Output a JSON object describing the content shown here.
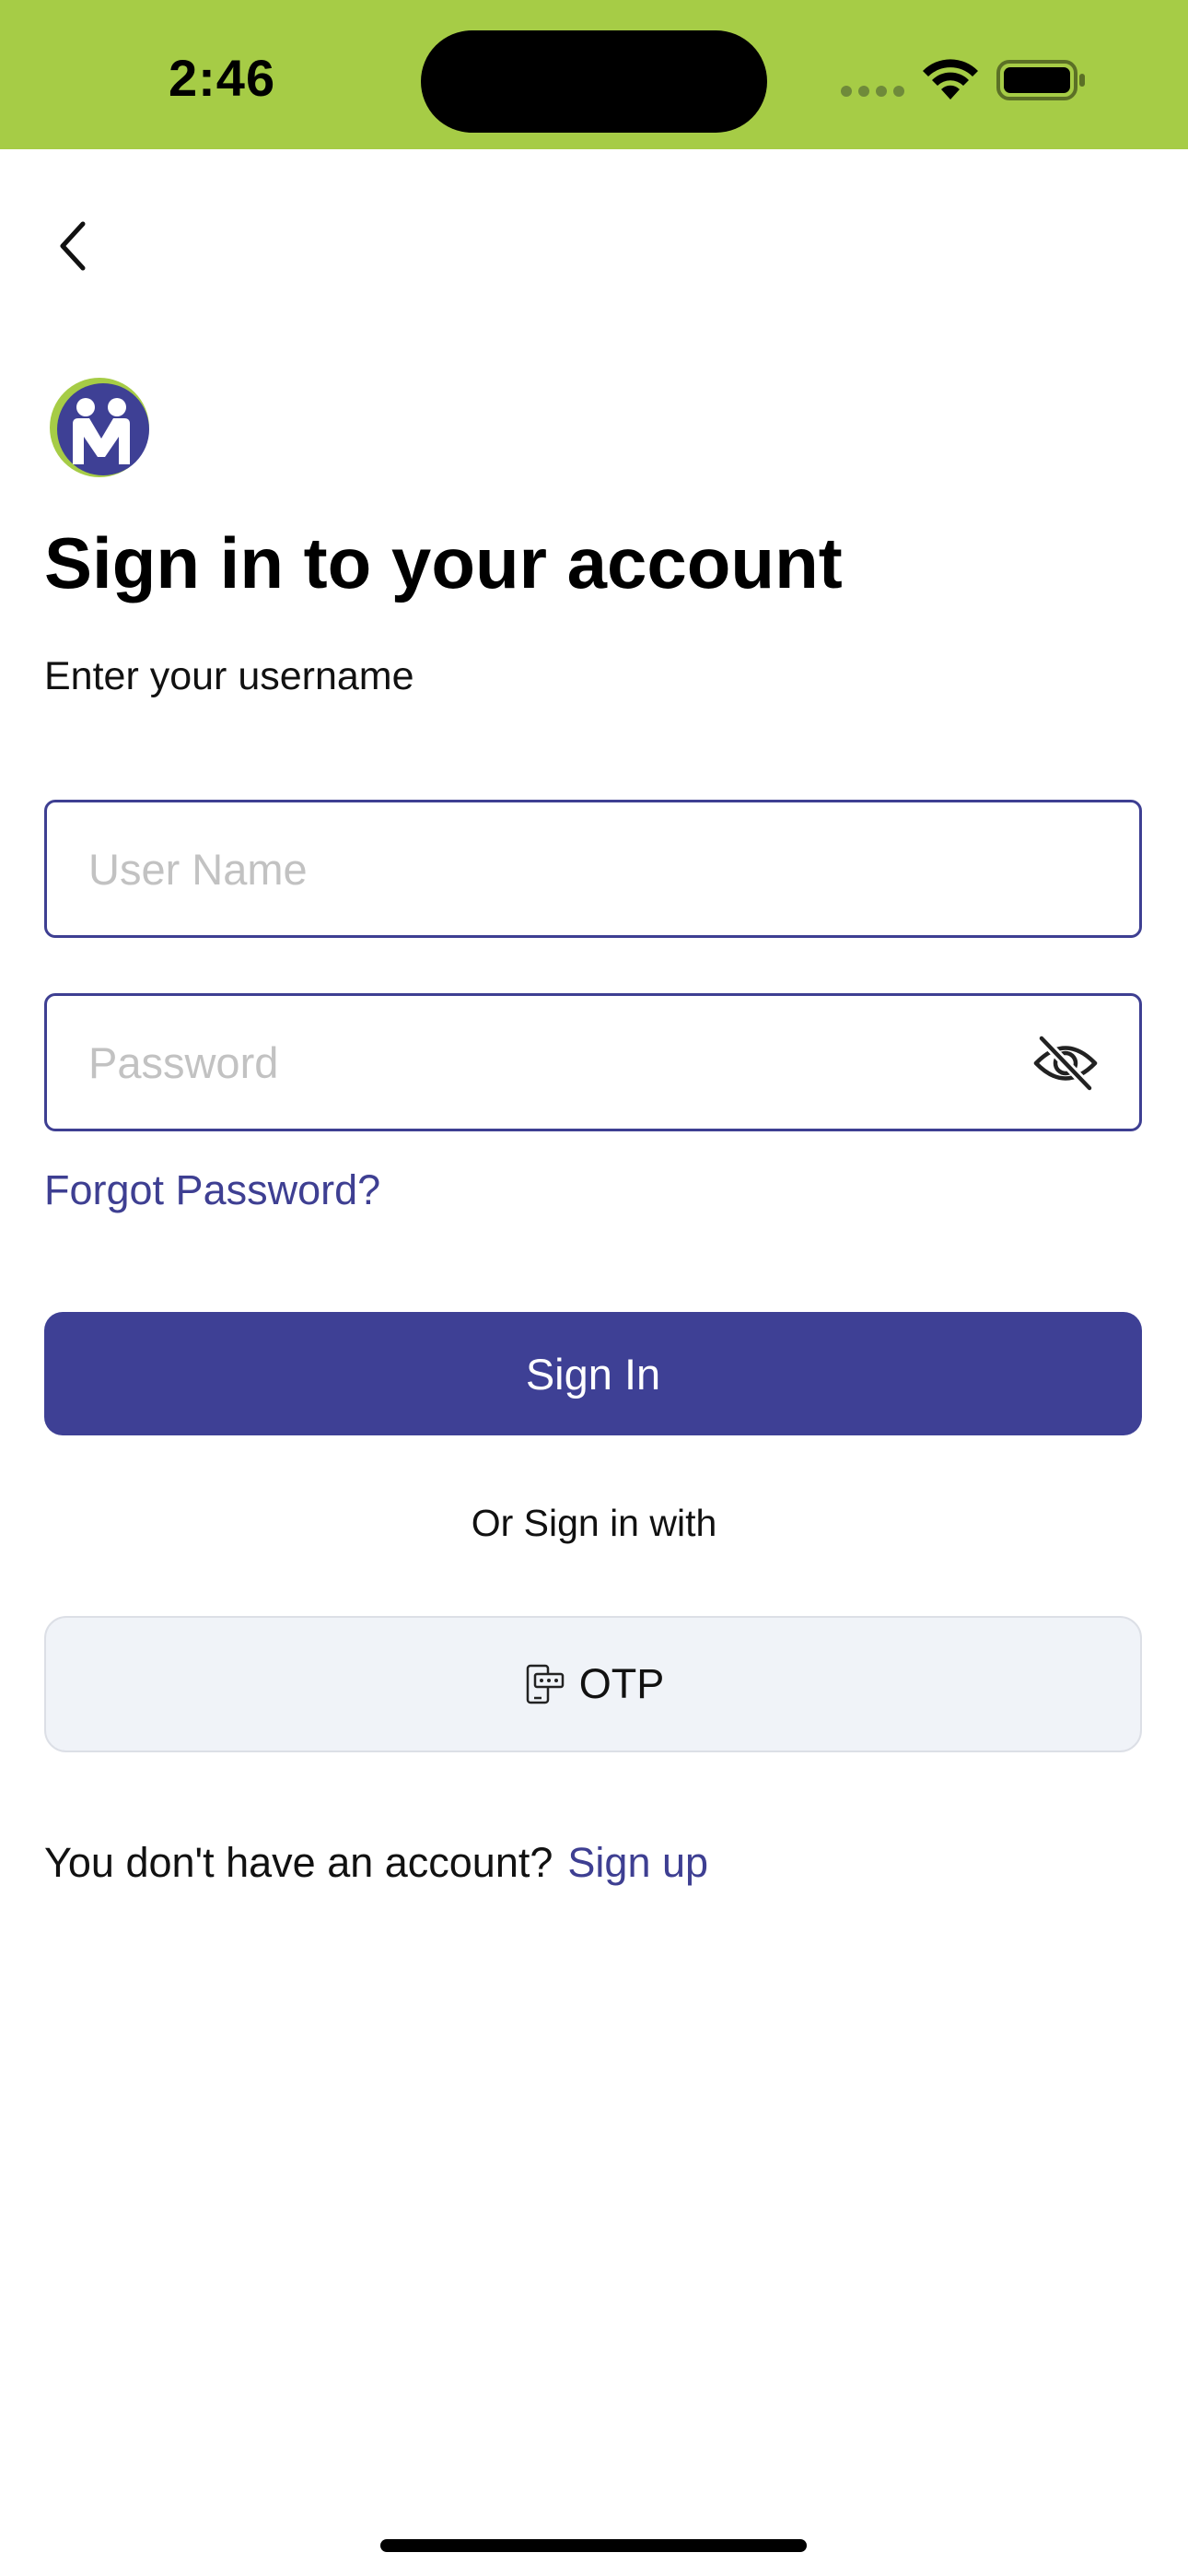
{
  "status_bar": {
    "time": "2:46",
    "background_color": "#a6cc46"
  },
  "header": {
    "back_icon": "chevron-left-icon",
    "logo_icon": "m-people-logo-icon"
  },
  "main": {
    "title": "Sign in to your account",
    "subtitle": "Enter your username",
    "username_input": {
      "value": "",
      "placeholder": "User Name"
    },
    "password_input": {
      "value": "",
      "placeholder": "Password",
      "toggle_icon": "eye-slash-icon"
    },
    "forgot_password_label": "Forgot Password?",
    "sign_in_label": "Sign In",
    "alt_signin_text": "Or Sign in with",
    "otp_button": {
      "label": "OTP",
      "icon": "otp-device-icon"
    },
    "signup": {
      "prompt": "You don't have an account?",
      "link_label": "Sign up"
    }
  },
  "colors": {
    "primary": "#3e4095",
    "accent_green": "#a6cc46",
    "otp_button_bg": "#f0f3f8"
  }
}
